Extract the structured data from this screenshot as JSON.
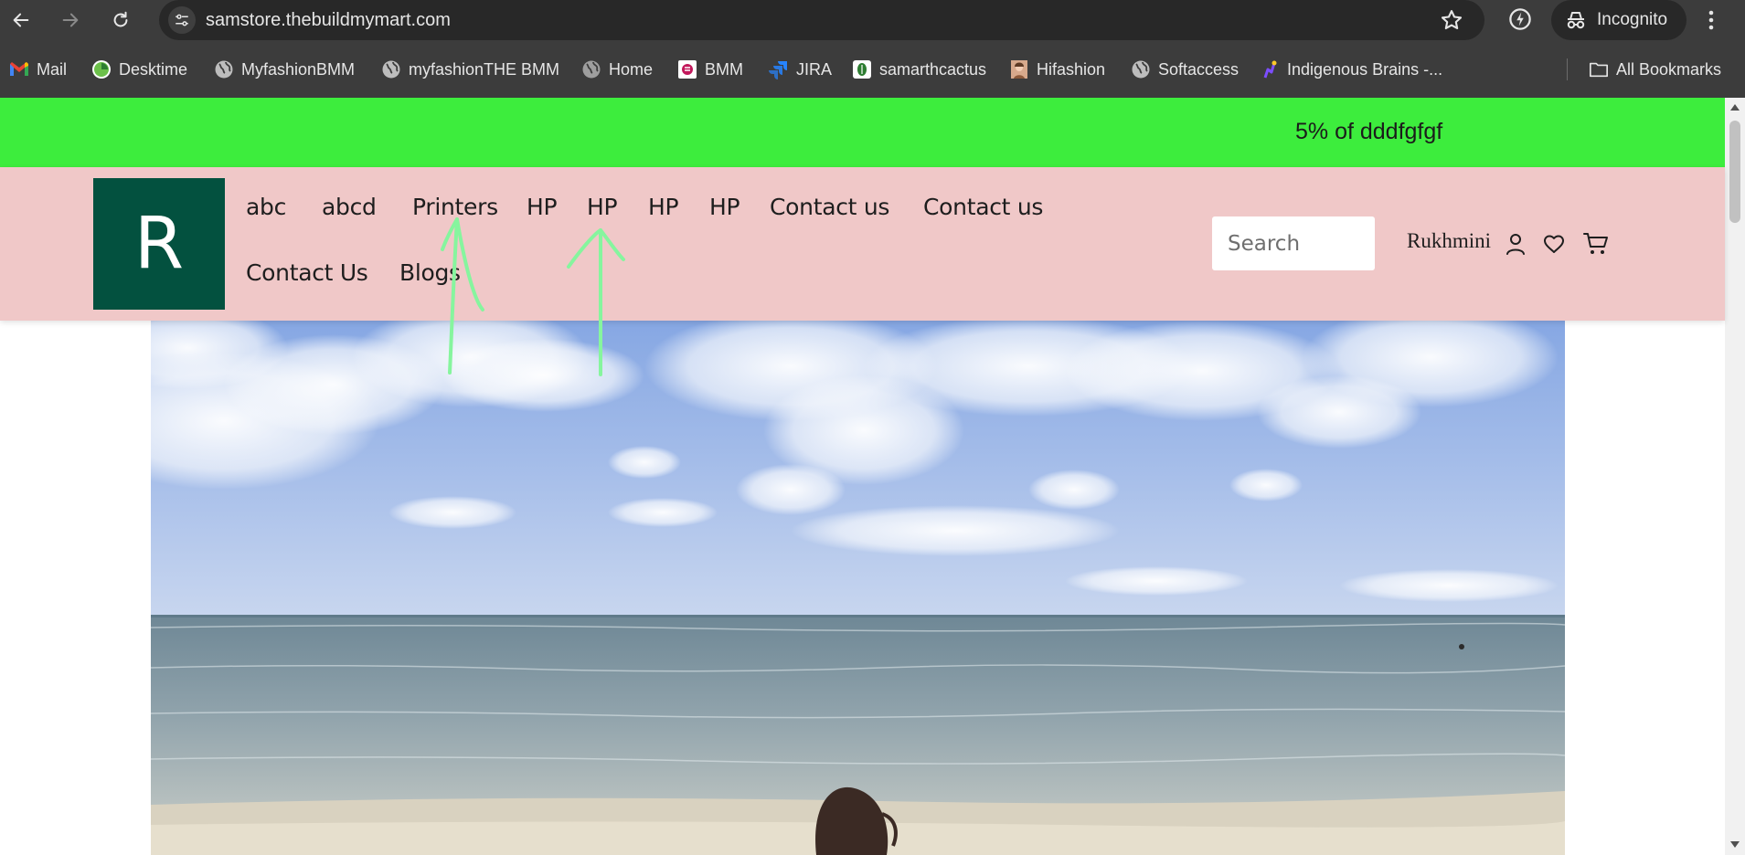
{
  "browser": {
    "url": "samstore.thebuildmymart.com",
    "mode_label": "Incognito"
  },
  "bookmarks": {
    "items": [
      {
        "label": "Mail",
        "icon": "gmail-icon"
      },
      {
        "label": "Desktime",
        "icon": "desktime-icon"
      },
      {
        "label": "MyfashionBMM",
        "icon": "globe-icon"
      },
      {
        "label": "myfashionTHE BMM",
        "icon": "globe-icon"
      },
      {
        "label": "Home",
        "icon": "globe-icon"
      },
      {
        "label": "BMM",
        "icon": "bmm-icon"
      },
      {
        "label": "JIRA",
        "icon": "jira-icon"
      },
      {
        "label": "samarthcactus",
        "icon": "cactus-icon"
      },
      {
        "label": "Hifashion",
        "icon": "portrait-icon"
      },
      {
        "label": "Softaccess",
        "icon": "globe-icon"
      },
      {
        "label": "Indigenous Brains -...",
        "icon": "brain-icon"
      }
    ],
    "all_label": "All Bookmarks"
  },
  "announcement": {
    "text": "5% of dddfgfgf",
    "color": "#3ded3d"
  },
  "header": {
    "background": "#f0c8c8",
    "logo_letter": "R",
    "logo_color": "#03513f",
    "menu": [
      "abc",
      "abcd",
      "Printers",
      "HP",
      "HP",
      "HP",
      "HP",
      "Contact us",
      "Contact us",
      "Contact Us",
      "Blogs"
    ],
    "search_placeholder": "Search",
    "username": "Rukhmini"
  },
  "annotation_color": "#86f59e"
}
